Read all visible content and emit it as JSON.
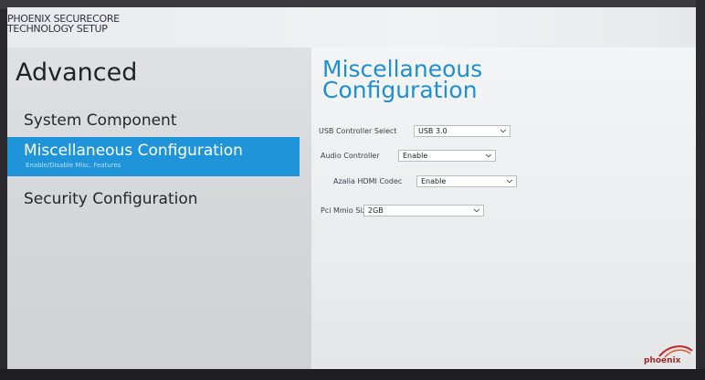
{
  "brand": {
    "line1": "PHOENIX SECURECORE",
    "line2": "TECHNOLOGY SETUP",
    "logo_text": "phoenix"
  },
  "nav": {
    "title": "Advanced",
    "items": [
      {
        "label": "System Component",
        "selected": false
      },
      {
        "label": "Miscellaneous Configuration",
        "selected": true,
        "description": "Enable/Disable Misc. Features"
      },
      {
        "label": "Security Configuration",
        "selected": false
      }
    ]
  },
  "section": {
    "title_line1": "Miscellaneous",
    "title_line2": "Configuration",
    "settings": [
      {
        "label": "USB Controller Select",
        "value": "USB 3.0"
      },
      {
        "label": "Audio Controller",
        "value": "Enable"
      },
      {
        "label": "Azalia HDMI Codec",
        "value": "Enable"
      },
      {
        "label": "Pci Mmio Size",
        "value": "2GB"
      }
    ]
  },
  "icons": {
    "dropdown": "chevron-down-icon",
    "logo": "phoenix-logo-icon"
  },
  "colors": {
    "accent": "#1f94d8",
    "title": "#1f8fd0"
  }
}
